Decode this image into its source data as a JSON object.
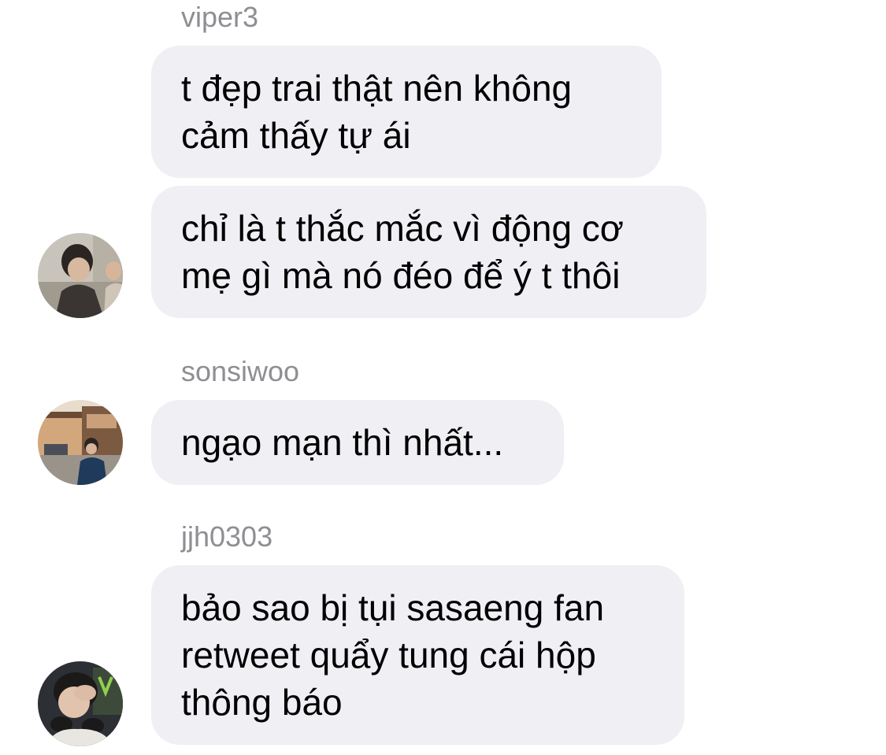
{
  "thread": {
    "groups": [
      {
        "username": "viper3",
        "messages": [
          "t đẹp trai thật nên không\ncảm thấy tự ái",
          "chỉ là t thắc mắc vì động cơ\nmẹ gì mà nó đéo để ý t thôi"
        ],
        "avatar_icon": "avatar-viper3-photo"
      },
      {
        "username": "sonsiwoo",
        "messages": [
          "ngạo mạn thì nhất..."
        ],
        "avatar_icon": "avatar-sonsiwoo-photo"
      },
      {
        "username": "jjh0303",
        "messages": [
          "bảo sao bị tụi sasaeng fan\nretweet quẩy tung cái hộp\nthông báo"
        ],
        "avatar_icon": "avatar-jjh0303-photo"
      }
    ]
  },
  "colors": {
    "bubble": "#efeff4",
    "username": "#8e8e93",
    "text": "#000000",
    "background": "#ffffff"
  }
}
